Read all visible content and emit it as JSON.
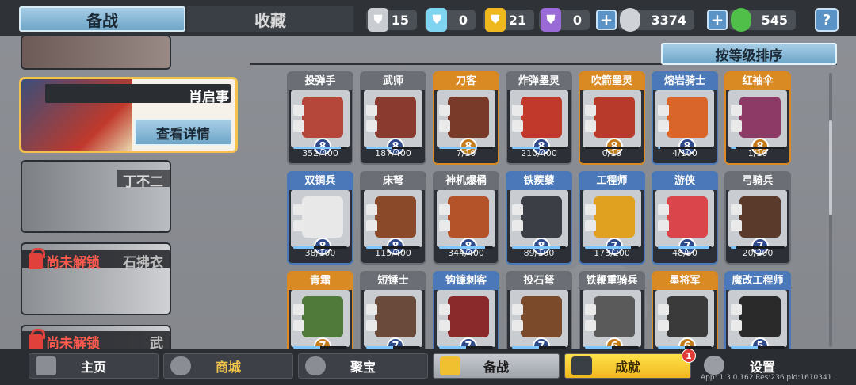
{
  "top_tabs": {
    "prepare": "备战",
    "collection": "收藏"
  },
  "resources": [
    {
      "icon": "silver-shield-icon",
      "value": "15",
      "color": "#c9ccd1"
    },
    {
      "icon": "crystal-shield-icon",
      "value": "0",
      "color": "#7fd4f2"
    },
    {
      "icon": "gold-shield-icon",
      "value": "21",
      "color": "#f0b81f"
    },
    {
      "icon": "purple-shield-icon",
      "value": "0",
      "color": "#9a6ad6"
    },
    {
      "icon": "silver-coin-icon",
      "value": "3374",
      "color": "#cfd2d6"
    },
    {
      "icon": "jade-coin-icon",
      "value": "545",
      "color": "#4fbf4a"
    }
  ],
  "help_label": "?",
  "heroes": [
    {
      "name": "",
      "state": "unlocked"
    },
    {
      "name": "肖启事",
      "state": "selected",
      "detail_button": "查看详情"
    },
    {
      "name": "丁不二",
      "state": "unlocked"
    },
    {
      "name": "石拂衣",
      "state": "locked",
      "lock_text": "尚未解锁"
    },
    {
      "name": "武",
      "state": "locked",
      "lock_text": "尚未解锁"
    }
  ],
  "sort_button": "按等级排序",
  "units": [
    {
      "name": "投弹手",
      "level": "8",
      "progress": "352/400",
      "ratio": 0.88,
      "head": "#6b6f75",
      "sprite": "#b4473a",
      "gold": false
    },
    {
      "name": "武师",
      "level": "8",
      "progress": "187/400",
      "ratio": 0.47,
      "head": "#6b6f75",
      "sprite": "#8a3a2e",
      "gold": false
    },
    {
      "name": "刀客",
      "level": "8",
      "progress": "7/10",
      "ratio": 0.7,
      "head": "#d98a23",
      "sprite": "#7a3a2a",
      "gold": true
    },
    {
      "name": "炸弹墨灵",
      "level": "8",
      "progress": "210/400",
      "ratio": 0.52,
      "head": "#6b6f75",
      "sprite": "#c0392b",
      "gold": false
    },
    {
      "name": "吹箭墨灵",
      "level": "8",
      "progress": "0/10",
      "ratio": 0.0,
      "head": "#d98a23",
      "sprite": "#b83a2a",
      "gold": true
    },
    {
      "name": "熔岩骑士",
      "level": "8",
      "progress": "4/100",
      "ratio": 0.04,
      "head": "#4a78b8",
      "sprite": "#d9652a",
      "gold": false
    },
    {
      "name": "红袖伞",
      "level": "8",
      "progress": "1/10",
      "ratio": 0.1,
      "head": "#d98a23",
      "sprite": "#8e3a66",
      "gold": true
    },
    {
      "name": "双锏兵",
      "level": "8",
      "progress": "38/100",
      "ratio": 0.38,
      "head": "#4a78b8",
      "sprite": "#e8e8e8",
      "gold": false
    },
    {
      "name": "床弩",
      "level": "8",
      "progress": "115/400",
      "ratio": 0.29,
      "head": "#6b6f75",
      "sprite": "#8a4a2a",
      "gold": false
    },
    {
      "name": "神机爆桶",
      "level": "8",
      "progress": "344/400",
      "ratio": 0.86,
      "head": "#6b6f75",
      "sprite": "#b4522a",
      "gold": false
    },
    {
      "name": "铁蒺藜",
      "level": "8",
      "progress": "89/100",
      "ratio": 0.89,
      "head": "#4a78b8",
      "sprite": "#3b3f45",
      "gold": false
    },
    {
      "name": "工程师",
      "level": "7",
      "progress": "173/200",
      "ratio": 0.86,
      "head": "#4a78b8",
      "sprite": "#e0a020",
      "gold": false
    },
    {
      "name": "游侠",
      "level": "7",
      "progress": "48/50",
      "ratio": 0.96,
      "head": "#4a78b8",
      "sprite": "#d9454a",
      "gold": false
    },
    {
      "name": "弓骑兵",
      "level": "7",
      "progress": "20/200",
      "ratio": 0.1,
      "head": "#6b6f75",
      "sprite": "#5a3a2a",
      "gold": false
    },
    {
      "name": "青霜",
      "level": "7",
      "progress": "",
      "ratio": 0.5,
      "head": "#d98a23",
      "sprite": "#4f7a3a",
      "gold": true
    },
    {
      "name": "短锤士",
      "level": "7",
      "progress": "",
      "ratio": 0.5,
      "head": "#6b6f75",
      "sprite": "#6a4a3a",
      "gold": false
    },
    {
      "name": "钩镰刺客",
      "level": "7",
      "progress": "",
      "ratio": 0.5,
      "head": "#4a78b8",
      "sprite": "#8a2a2a",
      "gold": false
    },
    {
      "name": "投石弩",
      "level": "7",
      "progress": "",
      "ratio": 0.5,
      "head": "#6b6f75",
      "sprite": "#7a4a2a",
      "gold": false
    },
    {
      "name": "铁鞭重骑兵",
      "level": "6",
      "progress": "",
      "ratio": 0.5,
      "head": "#6b6f75",
      "sprite": "#5a5a5a",
      "gold": true
    },
    {
      "name": "墨将军",
      "level": "6",
      "progress": "",
      "ratio": 0.5,
      "head": "#d98a23",
      "sprite": "#3a3a3a",
      "gold": true
    },
    {
      "name": "魔改工程师",
      "level": "5",
      "progress": "",
      "ratio": 0.5,
      "head": "#4a78b8",
      "sprite": "#2a2a2a",
      "gold": false
    }
  ],
  "bottom_nav": {
    "home": "主页",
    "shop": "商城",
    "treasure": "聚宝",
    "prepare": "备战",
    "achievements": "成就",
    "settings": "设置"
  },
  "achievement_badge": "1",
  "version_text": "App: 1.3.0.162 Res:236 pid:1610341"
}
